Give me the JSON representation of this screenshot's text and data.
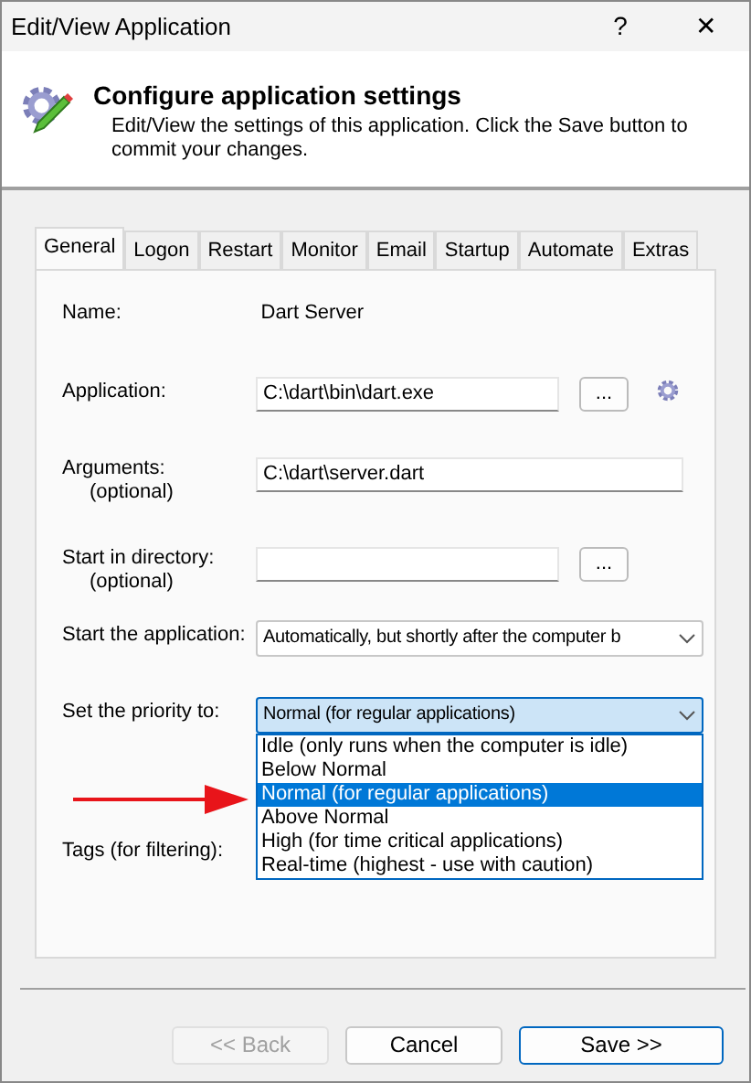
{
  "window": {
    "title": "Edit/View Application",
    "help": "?",
    "close": "✕"
  },
  "header": {
    "title": "Configure application settings",
    "description": "Edit/View the settings of this application. Click the Save button to commit your changes."
  },
  "tabs": [
    {
      "label": "General",
      "selected": true
    },
    {
      "label": "Logon",
      "selected": false
    },
    {
      "label": "Restart",
      "selected": false
    },
    {
      "label": "Monitor",
      "selected": false
    },
    {
      "label": "Email",
      "selected": false
    },
    {
      "label": "Startup",
      "selected": false
    },
    {
      "label": "Automate",
      "selected": false
    },
    {
      "label": "Extras",
      "selected": false
    }
  ],
  "fields": [
    {
      "kind": "static",
      "label": "Name:",
      "value": "Dart Server"
    },
    {
      "kind": "path",
      "label": "Application:",
      "value": "C:\\dart\\bin\\dart.exe",
      "button": "...",
      "gear": true
    },
    {
      "kind": "text",
      "label": "Arguments:",
      "note": "(optional)",
      "value": "C:\\dart\\server.dart"
    },
    {
      "kind": "path",
      "label": "Start in directory:",
      "note": "(optional)",
      "button": "...",
      "gear": false
    },
    {
      "kind": "select",
      "label": "Start the application:",
      "value": "Automatically, but shortly after the computer b"
    },
    {
      "kind": "select",
      "label": "Set the priority to:",
      "value": "Normal (for regular applications)",
      "expanded": true,
      "options": [
        {
          "label": "Idle (only runs when the computer is idle)",
          "selected": false
        },
        {
          "label": "Below Normal",
          "selected": false
        },
        {
          "label": "Normal (for regular applications)",
          "selected": true
        },
        {
          "label": "Above Normal",
          "selected": false
        },
        {
          "label": "High (for time critical applications)",
          "selected": false
        },
        {
          "label": "Real-time (highest - use with caution)",
          "selected": false
        }
      ]
    },
    {
      "kind": "label",
      "label": "Tags (for filtering):"
    }
  ],
  "buttons": [
    {
      "label": "<< Back",
      "disabled": true,
      "primary": false
    },
    {
      "label": "Cancel",
      "disabled": false,
      "primary": false
    },
    {
      "label": "Save >>",
      "disabled": false,
      "primary": true
    }
  ]
}
